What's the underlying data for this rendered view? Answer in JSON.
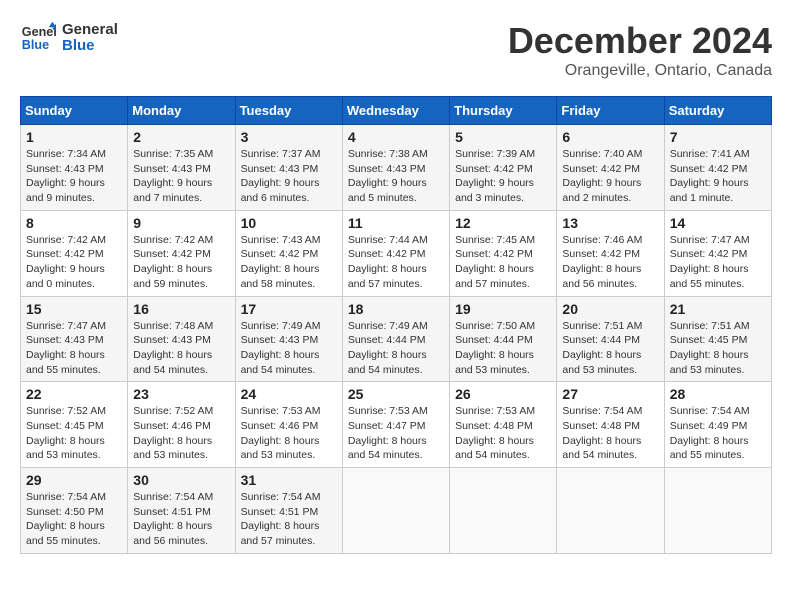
{
  "header": {
    "logo_line1": "General",
    "logo_line2": "Blue",
    "month": "December 2024",
    "location": "Orangeville, Ontario, Canada"
  },
  "weekdays": [
    "Sunday",
    "Monday",
    "Tuesday",
    "Wednesday",
    "Thursday",
    "Friday",
    "Saturday"
  ],
  "weeks": [
    [
      {
        "day": "1",
        "info": "Sunrise: 7:34 AM\nSunset: 4:43 PM\nDaylight: 9 hours and 9 minutes."
      },
      {
        "day": "2",
        "info": "Sunrise: 7:35 AM\nSunset: 4:43 PM\nDaylight: 9 hours and 7 minutes."
      },
      {
        "day": "3",
        "info": "Sunrise: 7:37 AM\nSunset: 4:43 PM\nDaylight: 9 hours and 6 minutes."
      },
      {
        "day": "4",
        "info": "Sunrise: 7:38 AM\nSunset: 4:43 PM\nDaylight: 9 hours and 5 minutes."
      },
      {
        "day": "5",
        "info": "Sunrise: 7:39 AM\nSunset: 4:42 PM\nDaylight: 9 hours and 3 minutes."
      },
      {
        "day": "6",
        "info": "Sunrise: 7:40 AM\nSunset: 4:42 PM\nDaylight: 9 hours and 2 minutes."
      },
      {
        "day": "7",
        "info": "Sunrise: 7:41 AM\nSunset: 4:42 PM\nDaylight: 9 hours and 1 minute."
      }
    ],
    [
      {
        "day": "8",
        "info": "Sunrise: 7:42 AM\nSunset: 4:42 PM\nDaylight: 9 hours and 0 minutes."
      },
      {
        "day": "9",
        "info": "Sunrise: 7:42 AM\nSunset: 4:42 PM\nDaylight: 8 hours and 59 minutes."
      },
      {
        "day": "10",
        "info": "Sunrise: 7:43 AM\nSunset: 4:42 PM\nDaylight: 8 hours and 58 minutes."
      },
      {
        "day": "11",
        "info": "Sunrise: 7:44 AM\nSunset: 4:42 PM\nDaylight: 8 hours and 57 minutes."
      },
      {
        "day": "12",
        "info": "Sunrise: 7:45 AM\nSunset: 4:42 PM\nDaylight: 8 hours and 57 minutes."
      },
      {
        "day": "13",
        "info": "Sunrise: 7:46 AM\nSunset: 4:42 PM\nDaylight: 8 hours and 56 minutes."
      },
      {
        "day": "14",
        "info": "Sunrise: 7:47 AM\nSunset: 4:42 PM\nDaylight: 8 hours and 55 minutes."
      }
    ],
    [
      {
        "day": "15",
        "info": "Sunrise: 7:47 AM\nSunset: 4:43 PM\nDaylight: 8 hours and 55 minutes."
      },
      {
        "day": "16",
        "info": "Sunrise: 7:48 AM\nSunset: 4:43 PM\nDaylight: 8 hours and 54 minutes."
      },
      {
        "day": "17",
        "info": "Sunrise: 7:49 AM\nSunset: 4:43 PM\nDaylight: 8 hours and 54 minutes."
      },
      {
        "day": "18",
        "info": "Sunrise: 7:49 AM\nSunset: 4:44 PM\nDaylight: 8 hours and 54 minutes."
      },
      {
        "day": "19",
        "info": "Sunrise: 7:50 AM\nSunset: 4:44 PM\nDaylight: 8 hours and 53 minutes."
      },
      {
        "day": "20",
        "info": "Sunrise: 7:51 AM\nSunset: 4:44 PM\nDaylight: 8 hours and 53 minutes."
      },
      {
        "day": "21",
        "info": "Sunrise: 7:51 AM\nSunset: 4:45 PM\nDaylight: 8 hours and 53 minutes."
      }
    ],
    [
      {
        "day": "22",
        "info": "Sunrise: 7:52 AM\nSunset: 4:45 PM\nDaylight: 8 hours and 53 minutes."
      },
      {
        "day": "23",
        "info": "Sunrise: 7:52 AM\nSunset: 4:46 PM\nDaylight: 8 hours and 53 minutes."
      },
      {
        "day": "24",
        "info": "Sunrise: 7:53 AM\nSunset: 4:46 PM\nDaylight: 8 hours and 53 minutes."
      },
      {
        "day": "25",
        "info": "Sunrise: 7:53 AM\nSunset: 4:47 PM\nDaylight: 8 hours and 54 minutes."
      },
      {
        "day": "26",
        "info": "Sunrise: 7:53 AM\nSunset: 4:48 PM\nDaylight: 8 hours and 54 minutes."
      },
      {
        "day": "27",
        "info": "Sunrise: 7:54 AM\nSunset: 4:48 PM\nDaylight: 8 hours and 54 minutes."
      },
      {
        "day": "28",
        "info": "Sunrise: 7:54 AM\nSunset: 4:49 PM\nDaylight: 8 hours and 55 minutes."
      }
    ],
    [
      {
        "day": "29",
        "info": "Sunrise: 7:54 AM\nSunset: 4:50 PM\nDaylight: 8 hours and 55 minutes."
      },
      {
        "day": "30",
        "info": "Sunrise: 7:54 AM\nSunset: 4:51 PM\nDaylight: 8 hours and 56 minutes."
      },
      {
        "day": "31",
        "info": "Sunrise: 7:54 AM\nSunset: 4:51 PM\nDaylight: 8 hours and 57 minutes."
      },
      {
        "day": "",
        "info": ""
      },
      {
        "day": "",
        "info": ""
      },
      {
        "day": "",
        "info": ""
      },
      {
        "day": "",
        "info": ""
      }
    ]
  ]
}
